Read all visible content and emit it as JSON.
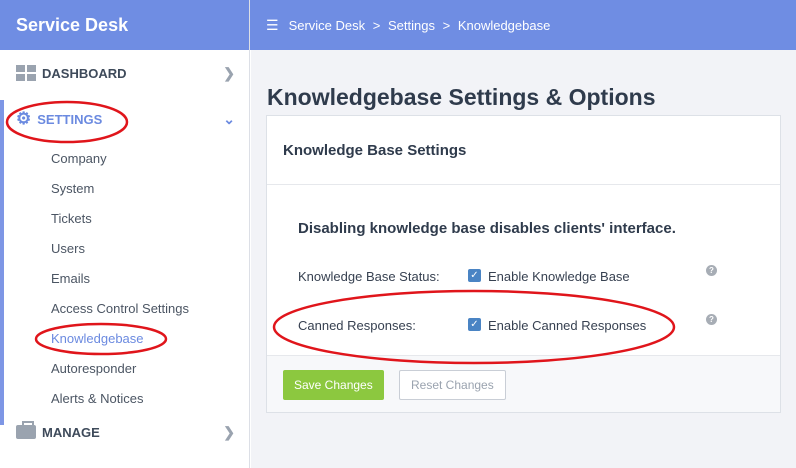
{
  "app": {
    "brand": "Service Desk"
  },
  "breadcrumb": {
    "items": [
      "Service Desk",
      "Settings",
      "Knowledgebase"
    ],
    "separator": ">"
  },
  "sidebar": {
    "dashboard_label": "DASHBOARD",
    "settings_label": "SETTINGS",
    "manage_label": "MANAGE",
    "sub_items": [
      "Company",
      "System",
      "Tickets",
      "Users",
      "Emails",
      "Access Control Settings",
      "Knowledgebase",
      "Autoresponder",
      "Alerts & Notices"
    ],
    "current_item": "Knowledgebase"
  },
  "page": {
    "title": "Knowledgebase Settings & Options",
    "panel_title": "Knowledge Base Settings",
    "warning": "Disabling knowledge base disables clients' interface.",
    "rows": [
      {
        "label": "Knowledge Base Status:",
        "option": "Enable Knowledge Base",
        "checked": true
      },
      {
        "label": "Canned Responses:",
        "option": "Enable Canned Responses",
        "checked": true
      }
    ],
    "help_glyph": "?",
    "save_label": "Save Changes",
    "reset_label": "Reset Changes"
  },
  "colors": {
    "header": "#6f8de3",
    "accent": "#6b8ae0",
    "save_button": "#8cc83f",
    "annotation": "#e0151b"
  },
  "icons": {
    "dashboard": "dashboard-grid-icon",
    "settings": "gear-icon",
    "manage": "briefcase-icon",
    "menu": "hamburger-icon",
    "expand": "chevron-right-icon",
    "collapse": "chevron-down-icon",
    "check": "checkmark-icon",
    "help": "help-icon"
  }
}
